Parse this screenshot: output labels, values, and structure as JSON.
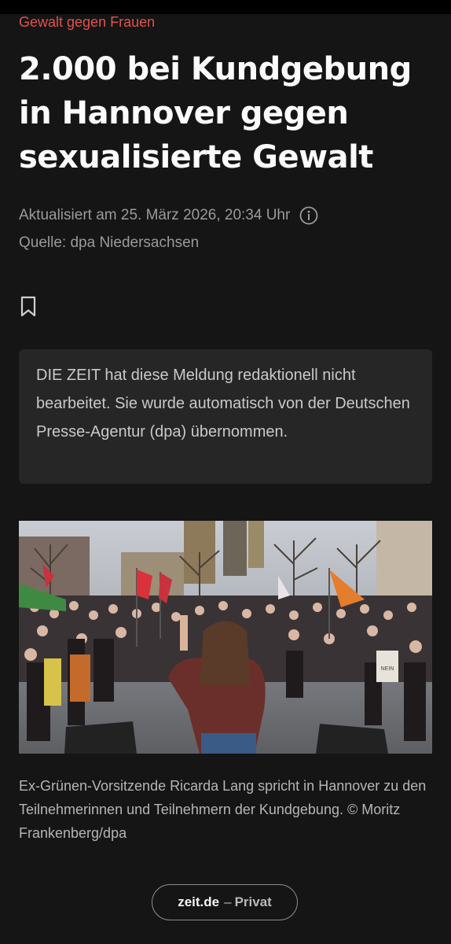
{
  "article": {
    "kicker": "Gewalt gegen Frauen",
    "headline": "2.000 bei Kundgebung in Hannover gegen sexualisierte Gewalt",
    "updated": "Aktualisiert am 25. März 2026, 20:34 Uhr",
    "source": "Quelle: dpa Niedersachsen",
    "notice": "DIE ZEIT hat diese Meldung redaktionell nicht bearbeitet. Sie wurde automatisch von der Deutschen Presse-Agentur (dpa) übernommen.",
    "caption": "Ex-Grünen-Vorsitzende Ricarda Lang spricht in Hannover zu den Teilnehmerinnen und Teilnehmern der Kundgebung. © Moritz Frankenberg/dpa",
    "photo_sign_text": "NEIN"
  },
  "icons": {
    "info": "info-icon",
    "bookmark": "bookmark-icon"
  },
  "browser": {
    "domain": "zeit.de",
    "separator": "–",
    "mode": "Privat"
  },
  "colors": {
    "kicker": "#e0524f",
    "background": "#151515",
    "notice_bg": "#262626"
  }
}
